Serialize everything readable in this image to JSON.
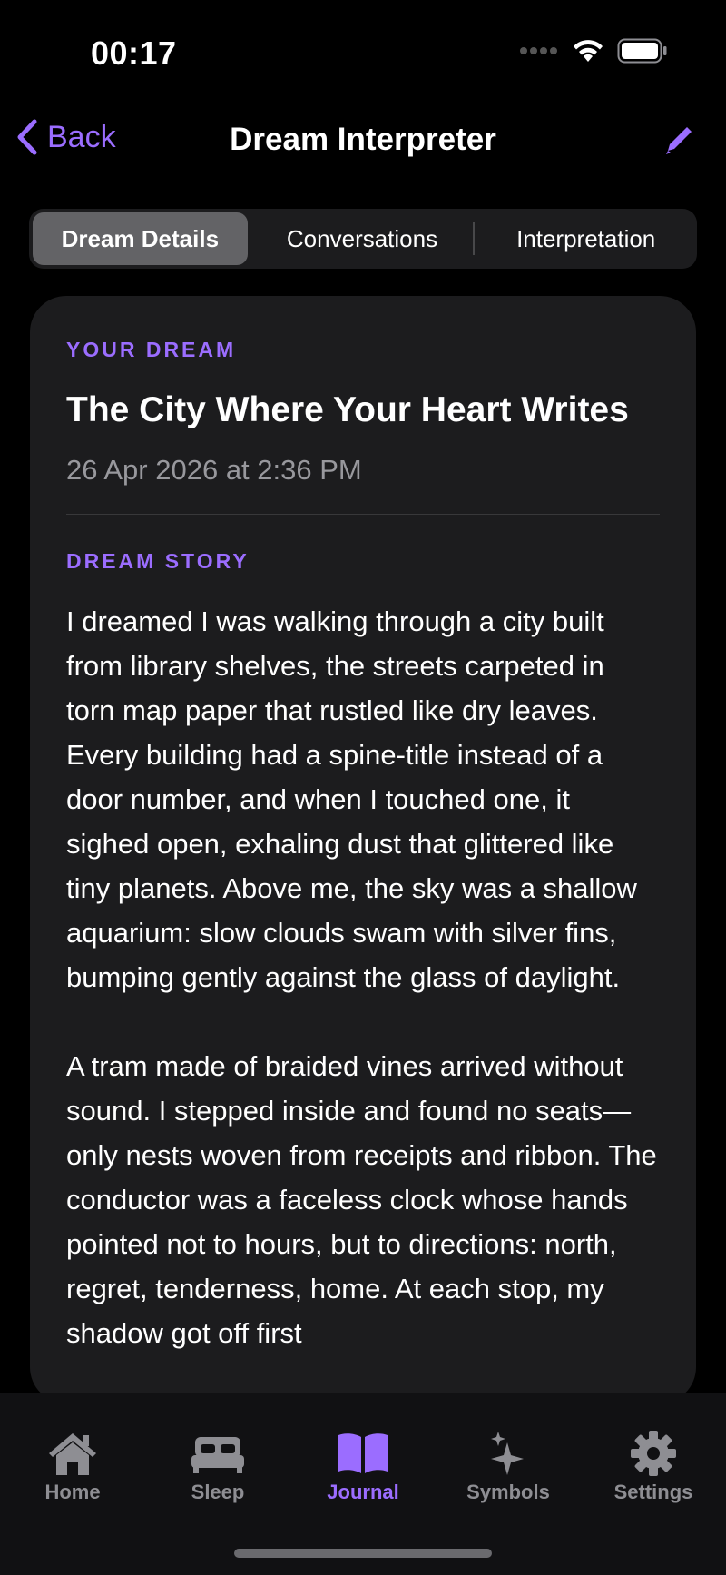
{
  "status_bar": {
    "time": "00:17"
  },
  "nav": {
    "back_label": "Back",
    "title": "Dream Interpreter"
  },
  "segments": {
    "details": "Dream Details",
    "conversations": "Conversations",
    "interpretation": "Interpretation",
    "selected": "Dream Details"
  },
  "card": {
    "your_dream_label": "YOUR DREAM",
    "title": "The City Where Your Heart Writes",
    "date": "26 Apr 2026 at 2:36 PM",
    "story_label": "DREAM STORY",
    "story": "I dreamed I was walking through a city built from library shelves, the streets carpeted in torn map paper that rustled like dry leaves. Every building had a spine-title instead of a door number, and when I touched one, it sighed open, exhaling dust that glittered like tiny planets. Above me, the sky was a shallow aquarium: slow clouds swam with silver fins, bumping gently against the glass of daylight.\n\nA tram made of braided vines arrived without sound. I stepped inside and found no seats—only nests woven from receipts and ribbon. The conductor was a faceless clock whose hands pointed not to hours, but to directions: north, regret, tenderness, home. At each stop, my shadow got off first"
  },
  "tabs": [
    {
      "label": "Home",
      "icon": "house-icon"
    },
    {
      "label": "Sleep",
      "icon": "bed-icon"
    },
    {
      "label": "Journal",
      "icon": "book-icon"
    },
    {
      "label": "Symbols",
      "icon": "sparkles-icon"
    },
    {
      "label": "Settings",
      "icon": "gear-icon"
    }
  ],
  "active_tab": "Journal",
  "colors": {
    "accent": "#9b6dff",
    "background": "#000000",
    "card": "#1c1c1e"
  }
}
